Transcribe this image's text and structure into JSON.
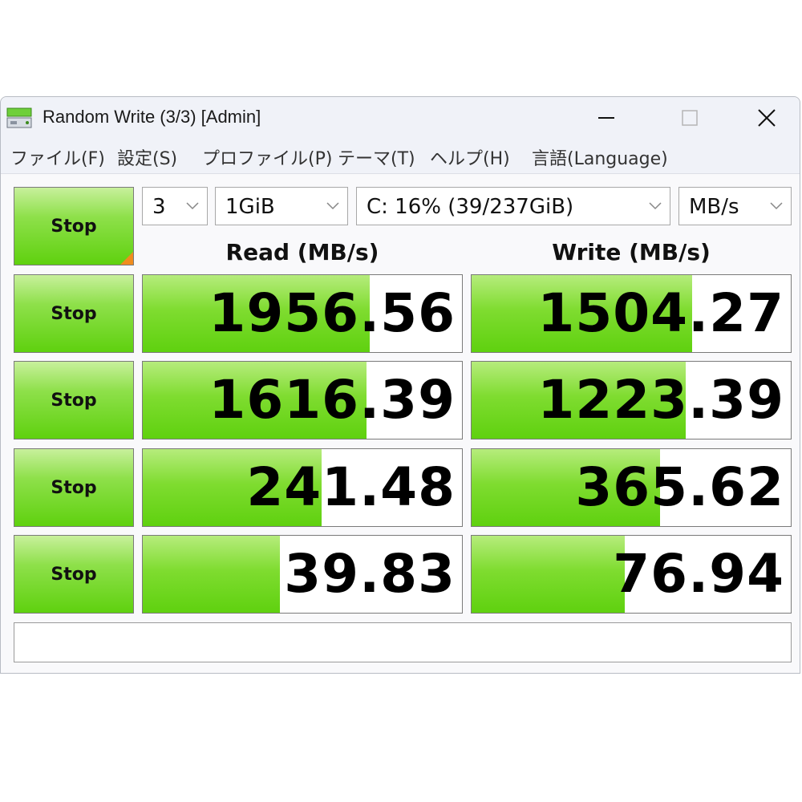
{
  "window": {
    "title": "Random Write (3/3) [Admin]",
    "controls": {
      "minimize": "minimize",
      "maximize": "maximize",
      "close": "close"
    }
  },
  "menu": {
    "items": [
      "ファイル(F)",
      "設定(S)",
      "プロファイル(P)",
      "テーマ(T)",
      "ヘルプ(H)",
      "言語(Language)"
    ]
  },
  "settings": {
    "count": "3",
    "size": "1GiB",
    "drive": "C: 16% (39/237GiB)",
    "unit": "MB/s"
  },
  "buttons": {
    "all_label": "Stop",
    "row_labels": [
      "Stop",
      "Stop",
      "Stop",
      "Stop"
    ]
  },
  "headers": {
    "read": "Read (MB/s)",
    "write": "Write (MB/s)"
  },
  "results": [
    {
      "read": "1956.56",
      "write": "1504.27",
      "read_fill": 0.71,
      "write_fill": 0.69
    },
    {
      "read": "1616.39",
      "write": "1223.39",
      "read_fill": 0.7,
      "write_fill": 0.67
    },
    {
      "read": "241.48",
      "write": "365.62",
      "read_fill": 0.56,
      "write_fill": 0.59
    },
    {
      "read": "39.83",
      "write": "76.94",
      "read_fill": 0.43,
      "write_fill": 0.48
    }
  ],
  "status": {
    "text": ""
  },
  "colors": {
    "accent_green": "#5fd10f",
    "corner_mark": "#f08c1e"
  },
  "icons": {
    "app": "disk-drive-icon",
    "combo_arrow": "chevron-down-icon"
  }
}
